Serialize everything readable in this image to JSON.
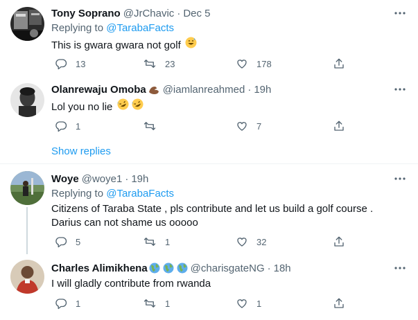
{
  "replying_label": "Replying to",
  "show_replies_label": "Show replies",
  "colors": {
    "link": "#1d9bf0",
    "muted": "#536471",
    "text": "#0f1419",
    "divider": "#eff3f4"
  },
  "tweets": [
    {
      "name": "Tony Soprano",
      "handle": "@JrChavic",
      "time": "Dec 5",
      "replying_to": "@TarabaFacts",
      "text": "This is gwara gwara not golf",
      "text_emoji": "grinning-sweat-emoji",
      "replies": "13",
      "retweets": "23",
      "likes": "178"
    },
    {
      "name": "Olanrewaju Omoba",
      "name_emoji": "flexed-biceps-emoji",
      "handle": "@iamlanreahmed",
      "time": "19h",
      "text": "Lol you no lie",
      "text_emoji": "rolling-laughing-emoji x2",
      "replies": "1",
      "retweets": "",
      "likes": "7"
    },
    {
      "name": "Woye",
      "handle": "@woye1",
      "time": "19h",
      "replying_to": "@TarabaFacts",
      "text": "Citizens of Taraba State , pls contribute and let us build a golf course . Darius can not shame us ooooo",
      "replies": "5",
      "retweets": "1",
      "likes": "32"
    },
    {
      "name": "Charles Alimikhena",
      "name_emoji": "globe-emoji x3",
      "handle": "@charisgateNG",
      "time": "18h",
      "text": "I will gladly contribute from rwanda",
      "replies": "1",
      "retweets": "1",
      "likes": "1"
    }
  ]
}
